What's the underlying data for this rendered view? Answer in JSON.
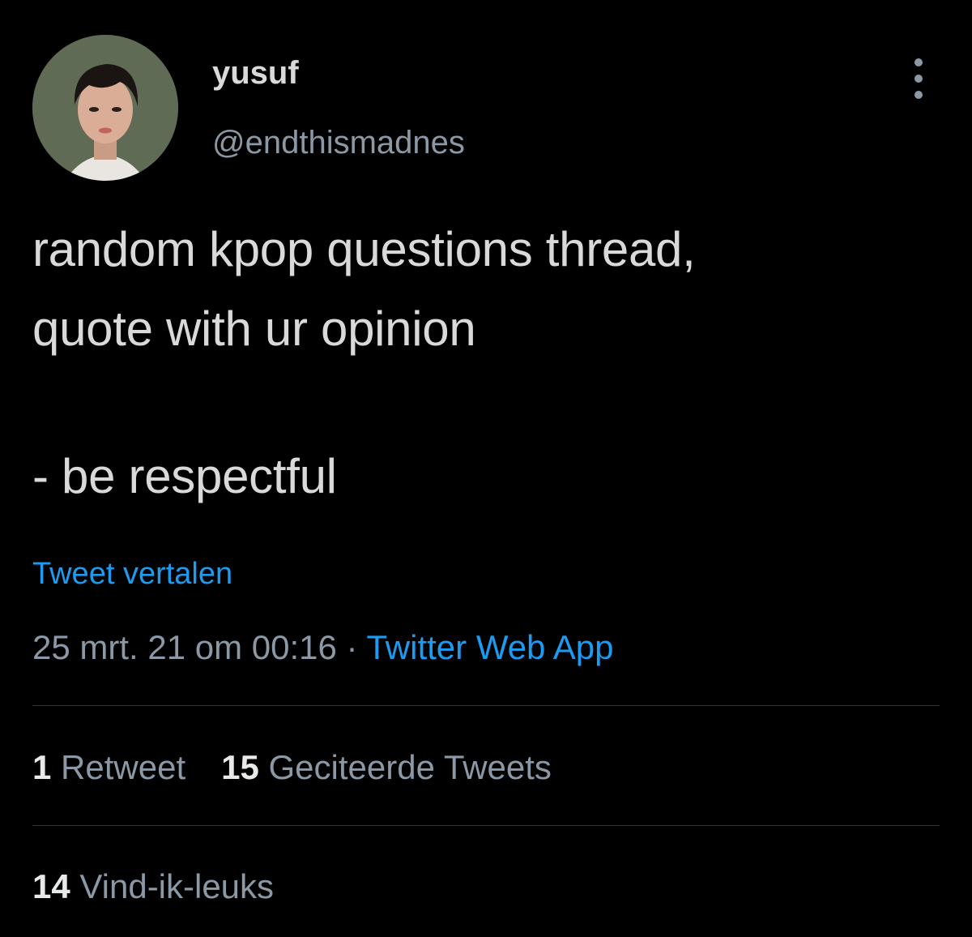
{
  "author": {
    "display_name": "yusuf",
    "handle": "@endthismadnes"
  },
  "tweet": {
    "line1": "random kpop questions thread,",
    "line2": "quote with ur opinion",
    "line3": "- be respectful",
    "translate_label": "Tweet vertalen"
  },
  "meta": {
    "timestamp": "25 mrt. 21 om 00:16",
    "separator": "·",
    "source": "Twitter Web App"
  },
  "stats": {
    "retweets_count": "1",
    "retweets_label": "Retweet",
    "quotes_count": "15",
    "quotes_label": "Geciteerde Tweets",
    "likes_count": "14",
    "likes_label": "Vind-ik-leuks"
  },
  "icons": {
    "more": "more-vertical-icon"
  },
  "colors": {
    "background": "#000000",
    "text": "#d9d9d9",
    "secondary": "#8b98a5",
    "link": "#1d9bf0",
    "divider": "#2f3336"
  }
}
